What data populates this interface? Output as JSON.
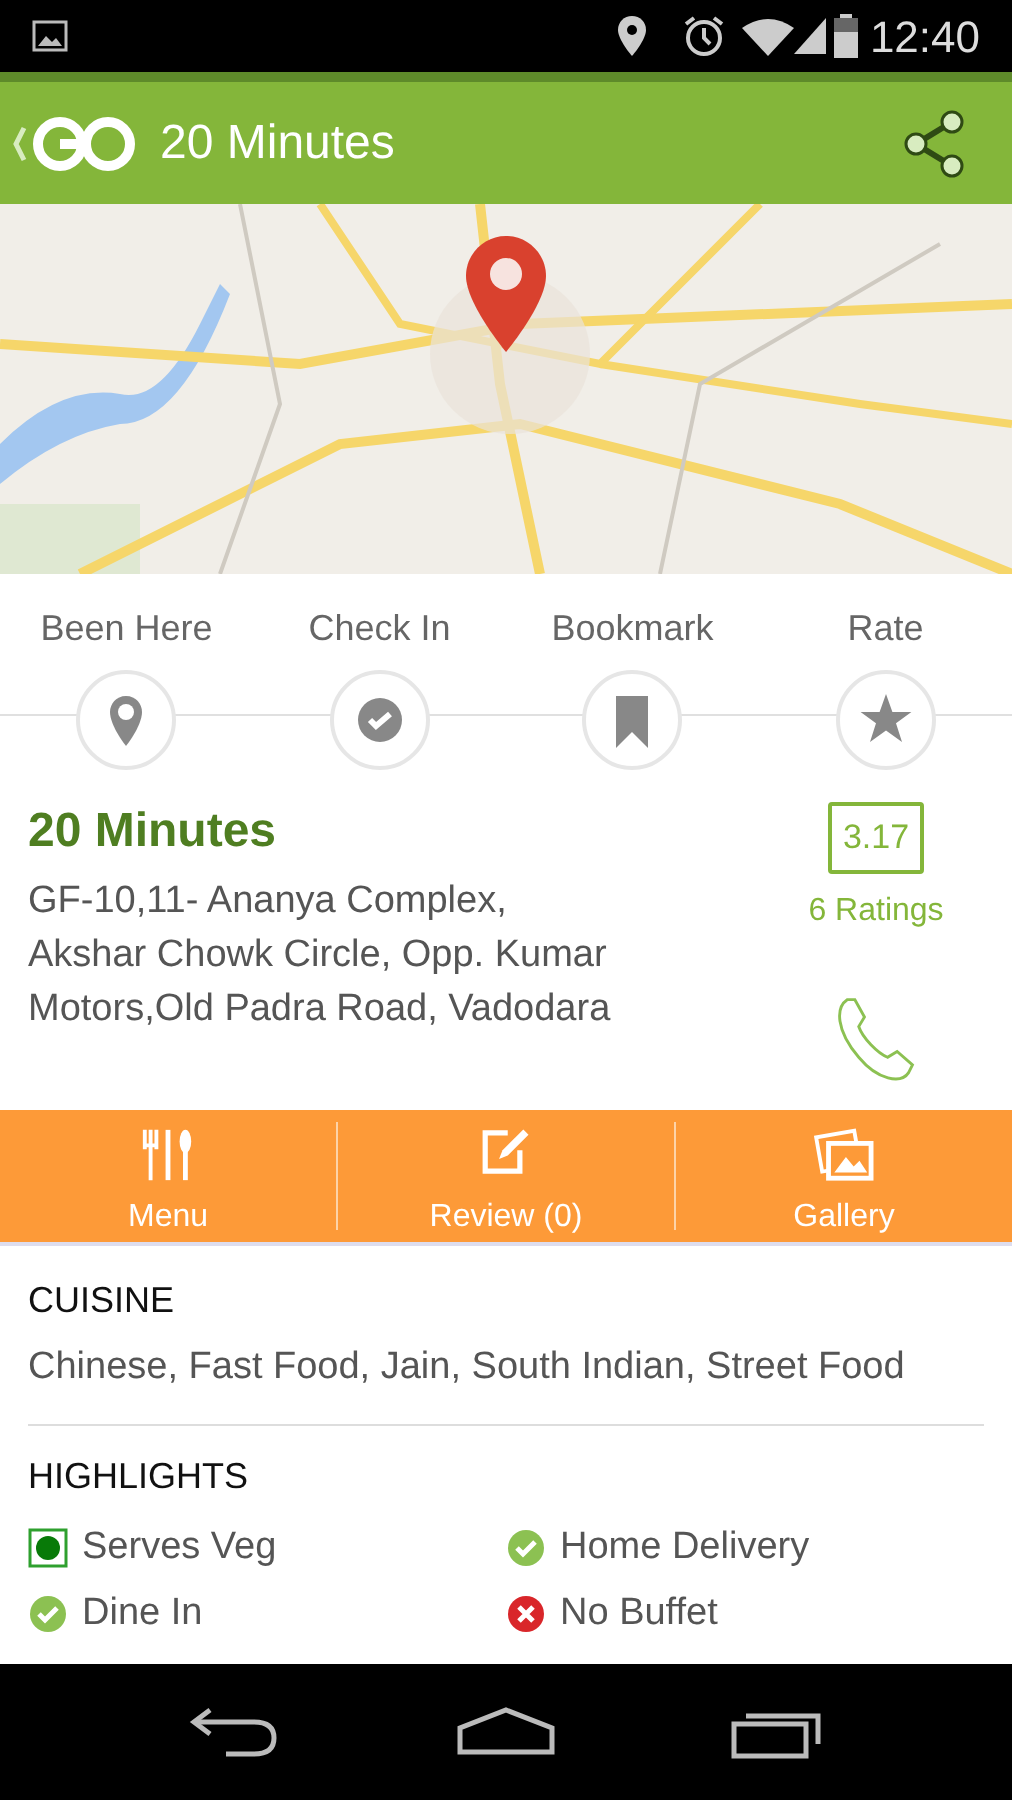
{
  "status_bar": {
    "time": "12:40"
  },
  "app_bar": {
    "title": "20 Minutes"
  },
  "actions": [
    {
      "label": "Been Here",
      "kind": "pin"
    },
    {
      "label": "Check In",
      "kind": "check"
    },
    {
      "label": "Bookmark",
      "kind": "bookmark"
    },
    {
      "label": "Rate",
      "kind": "star"
    }
  ],
  "place": {
    "name": "20 Minutes",
    "address": "GF-10,11- Ananya Complex, Akshar Chowk Circle, Opp. Kumar Motors,Old Padra Road, Vadodara",
    "rating": "3.17",
    "ratings_count": "6 Ratings"
  },
  "tabs": [
    {
      "label": "Menu",
      "kind": "menu"
    },
    {
      "label": "Review (0)",
      "kind": "review"
    },
    {
      "label": "Gallery",
      "kind": "gallery"
    }
  ],
  "cuisine": {
    "heading": "CUISINE",
    "text": "Chinese, Fast Food, Jain, South Indian, Street Food"
  },
  "highlights": {
    "heading": "HIGHLIGHTS",
    "items": [
      {
        "label": "Serves Veg",
        "kind": "veg"
      },
      {
        "label": "Home Delivery",
        "kind": "yes"
      },
      {
        "label": "Dine In",
        "kind": "yes"
      },
      {
        "label": "No Buffet",
        "kind": "no"
      }
    ]
  }
}
